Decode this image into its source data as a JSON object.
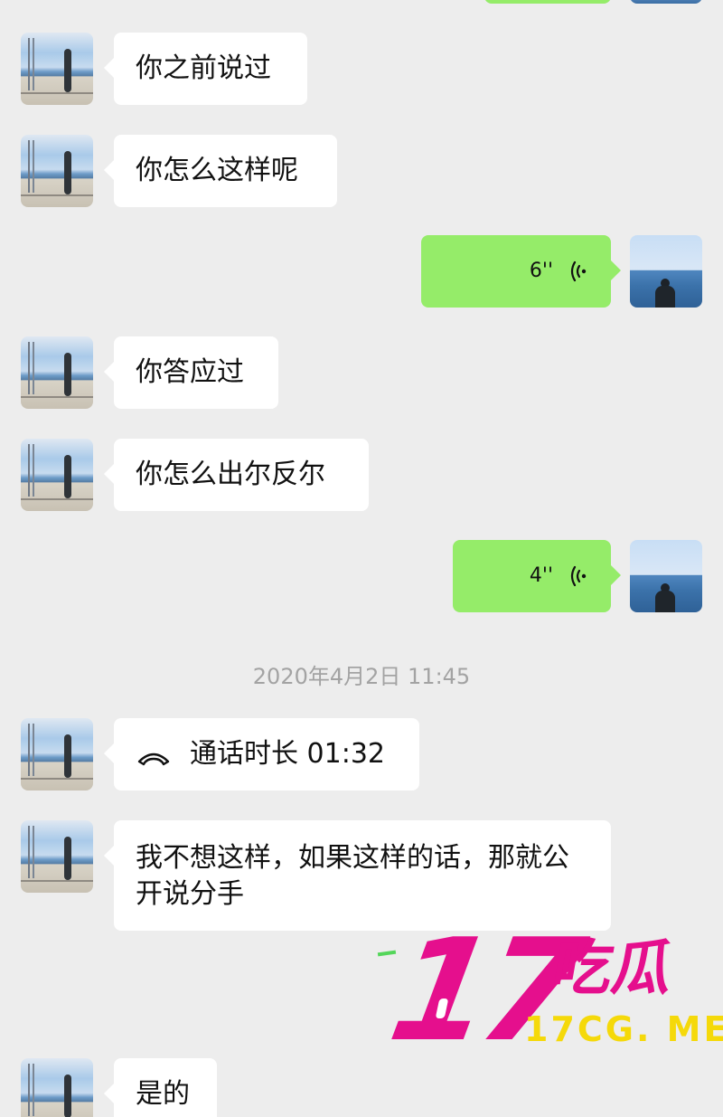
{
  "messages": {
    "m1": "你之前说过",
    "m2": "你怎么这样呢",
    "voice1": "6''",
    "m3": "你答应过",
    "m4": "你怎么出尔反尔",
    "voice2": "4''",
    "timestamp": "2020年4月2日 11:45",
    "call": "通话时长 01:32",
    "m5": "我不想这样，如果这样的话，那就公开说分手",
    "m6": "是的"
  },
  "watermark": {
    "number": "17",
    "chinese": "吃瓜",
    "domain": "17CG. ME"
  },
  "colors": {
    "background": "#ededed",
    "left_bubble": "#ffffff",
    "right_bubble": "#95ec69",
    "time_text": "#a3a3a3",
    "watermark_pink": "#e50f8d",
    "watermark_yellow": "#f5d90a"
  },
  "icons": {
    "voice": "voice-wave-icon",
    "call": "phone-hangup-icon"
  }
}
